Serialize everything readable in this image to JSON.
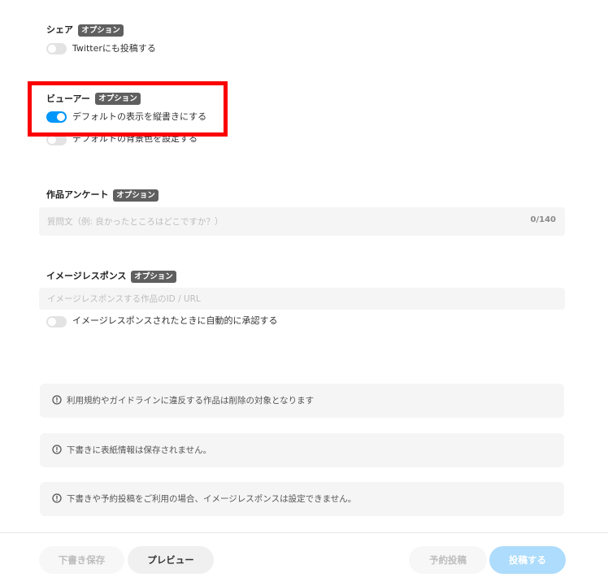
{
  "share": {
    "label": "シェア",
    "badge": "オプション",
    "twitter_toggle": {
      "label": "Twitterにも投稿する",
      "on": false
    }
  },
  "viewer": {
    "label": "ビューアー",
    "badge": "オプション",
    "vertical_toggle": {
      "label": "デフォルトの表示を縦書きにする",
      "on": true
    },
    "background_toggle": {
      "label": "デフォルトの背景色を設定する",
      "on": false
    }
  },
  "survey": {
    "label": "作品アンケート",
    "badge": "オプション",
    "placeholder": "質問文（例: 良かったところはどこですか？）",
    "counter": "0/140"
  },
  "image_response": {
    "label": "イメージレスポンス",
    "badge": "オプション",
    "placeholder": "イメージレスポンスする作品のID / URL",
    "auto_approve_toggle": {
      "label": "イメージレスポンスされたときに自動的に承認する",
      "on": false
    }
  },
  "notices": [
    "利用規約やガイドラインに違反する作品は削除の対象となります",
    "下書きに表紙情報は保存されません。",
    "下書きや予約投稿をご利用の場合、イメージレスポンスは設定できません。"
  ],
  "footer": {
    "save_draft_label": "下書き保存",
    "preview_label": "プレビュー",
    "schedule_label": "予約投稿",
    "post_label": "投稿する"
  },
  "colors": {
    "accent": "#0096fa",
    "highlight": "#fa0000",
    "post_button_disabled": "#addcfc",
    "badge_background": "#5f5f5f"
  },
  "icons": {
    "notice": "info-circle-icon"
  }
}
